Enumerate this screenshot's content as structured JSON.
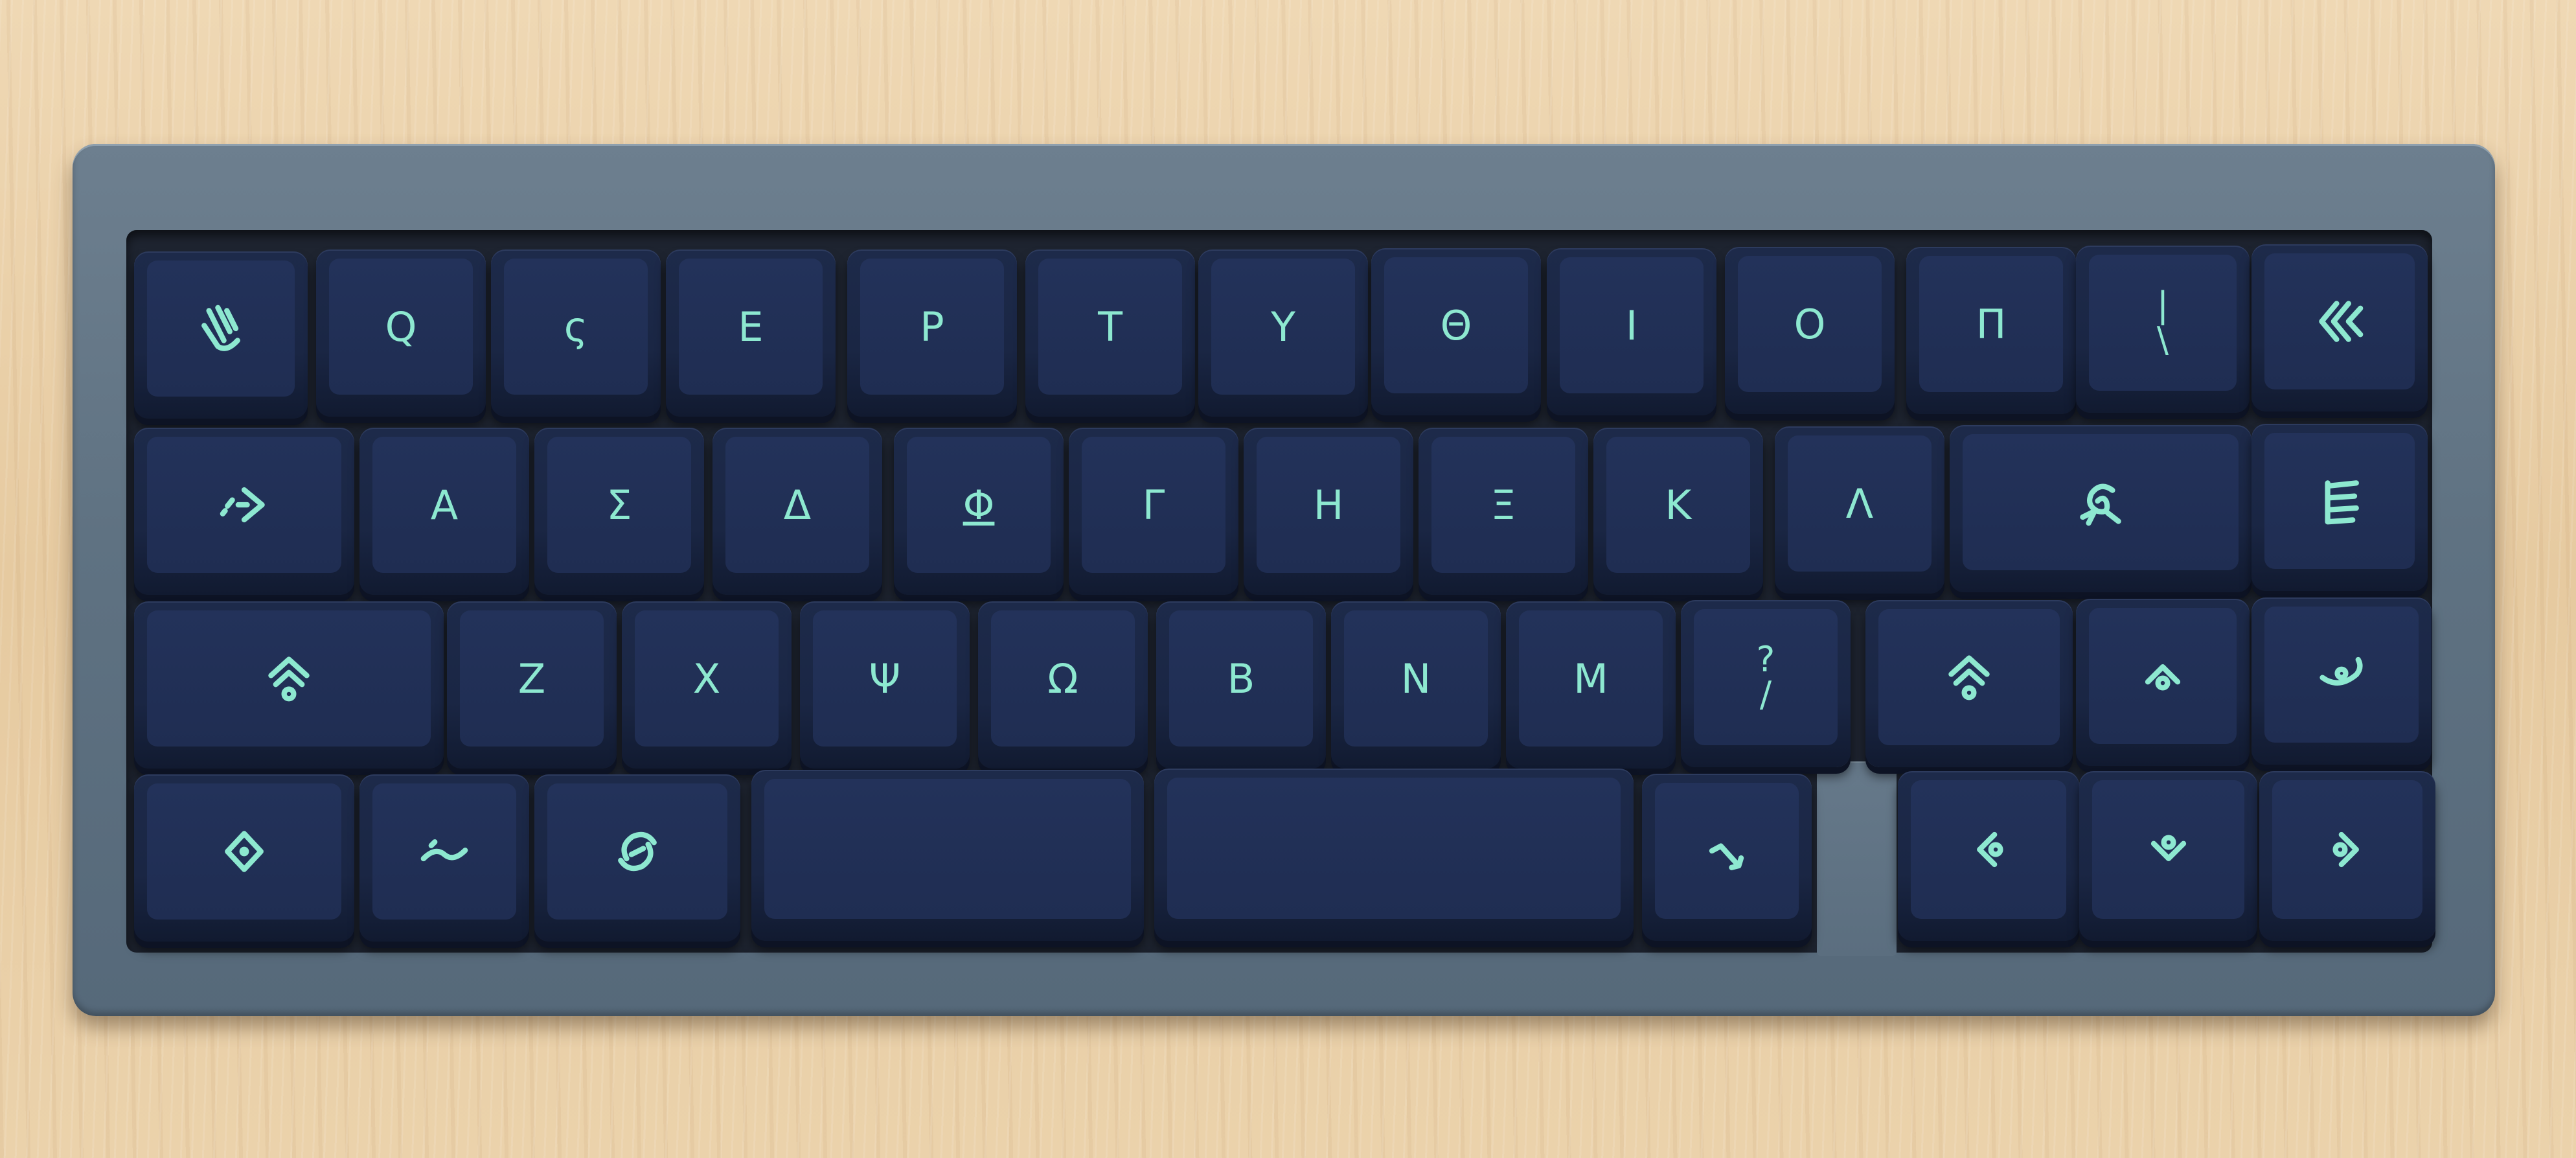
{
  "colors": {
    "legend": "#8de8d0",
    "keycap": "#1f2d52",
    "case": "#5f7282",
    "desk": "#e8cfa8"
  },
  "rows": [
    {
      "keys": [
        {
          "icon": "hand-icon"
        },
        {
          "label": "Q"
        },
        {
          "label": "ς"
        },
        {
          "label": "Ε"
        },
        {
          "label": "Ρ"
        },
        {
          "label": "Τ"
        },
        {
          "label": "Υ"
        },
        {
          "label": "Θ"
        },
        {
          "label": "Ι"
        },
        {
          "label": "Ο"
        },
        {
          "label": "Π"
        },
        {
          "top": "|",
          "bottom": "\\"
        },
        {
          "icon": "backspace-chevrons-icon"
        }
      ]
    },
    {
      "keys": [
        {
          "icon": "tab-arrow-icon"
        },
        {
          "label": "Α"
        },
        {
          "label": "Σ"
        },
        {
          "label": "Δ"
        },
        {
          "label": "Φ"
        },
        {
          "label": "Γ"
        },
        {
          "label": "Η"
        },
        {
          "label": "Ξ"
        },
        {
          "label": "Κ"
        },
        {
          "label": "Λ"
        },
        {
          "icon": "enter-swirl-icon"
        },
        {
          "icon": "menu-lines-icon"
        }
      ]
    },
    {
      "keys": [
        {
          "icon": "shift-layers-icon"
        },
        {
          "label": "Ζ"
        },
        {
          "label": "Χ"
        },
        {
          "label": "Ψ"
        },
        {
          "label": "Ω"
        },
        {
          "label": "Β"
        },
        {
          "label": "Ν"
        },
        {
          "label": "Μ"
        },
        {
          "top": "?",
          "bottom": "/"
        },
        {
          "icon": "shift-layers-icon"
        },
        {
          "icon": "up-eye-icon"
        },
        {
          "icon": "curl-eye-icon"
        }
      ]
    },
    {
      "keys": [
        {
          "icon": "diamond-eye-icon"
        },
        {
          "icon": "wave-icon"
        },
        {
          "icon": "spiral-eye-icon"
        },
        {
          "label": ""
        },
        {
          "label": ""
        },
        {
          "icon": "hook-arrow-icon"
        },
        {
          "icon": "left-eye-icon"
        },
        {
          "icon": "down-eye-icon"
        },
        {
          "icon": "right-eye-icon"
        }
      ]
    }
  ]
}
